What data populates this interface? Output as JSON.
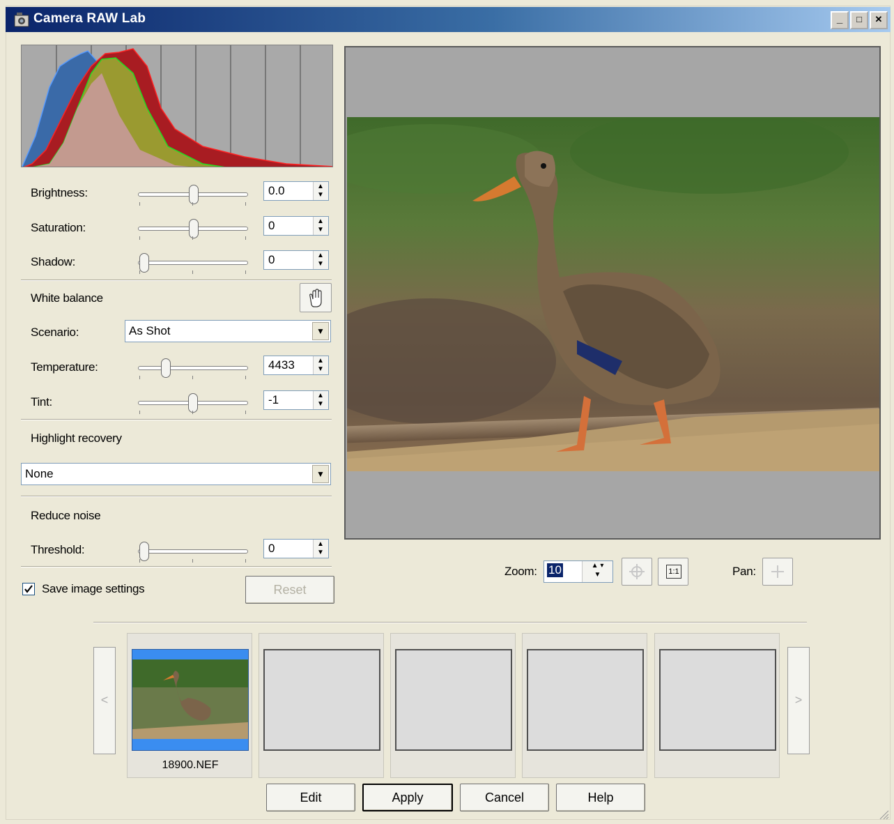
{
  "window": {
    "title": "Camera RAW Lab"
  },
  "titlebar_buttons": {
    "minimize": "_",
    "maximize": "□",
    "close": "✕"
  },
  "adjust": {
    "brightness": {
      "label": "Brightness:",
      "value": "0.0",
      "level": 0.5
    },
    "saturation": {
      "label": "Saturation:",
      "value": "0",
      "level": 0.5
    },
    "shadow": {
      "label": "Shadow:",
      "value": "0",
      "level": 0.0
    }
  },
  "white_balance": {
    "heading": "White balance",
    "scenario_label": "Scenario:",
    "scenario_value": "As Shot",
    "temperature": {
      "label": "Temperature:",
      "value": "4433",
      "level": 0.22
    },
    "tint": {
      "label": "Tint:",
      "value": "-1",
      "level": 0.49
    }
  },
  "highlight": {
    "heading": "Highlight recovery",
    "value": "None"
  },
  "noise": {
    "heading": "Reduce noise",
    "threshold": {
      "label": "Threshold:",
      "value": "0",
      "level": 0.0
    }
  },
  "save_settings": {
    "label": "Save image settings",
    "checked": true
  },
  "reset_label": "Reset",
  "zoom": {
    "label": "Zoom:",
    "value": "10"
  },
  "pan_label": "Pan:",
  "fit_button_label": "1:1",
  "filmstrip": {
    "prev": "<",
    "next": ">",
    "items": [
      {
        "name": "18900.NEF"
      },
      {
        "name": ""
      },
      {
        "name": ""
      },
      {
        "name": ""
      },
      {
        "name": ""
      }
    ]
  },
  "actions": {
    "edit": "Edit",
    "apply": "Apply",
    "cancel": "Cancel",
    "help": "Help"
  },
  "colors": {
    "accent_blue": "#3a8df0",
    "title_start": "#0a246a",
    "hist_red": "#c8102e",
    "hist_green": "#22cc22",
    "hist_blue": "#3366aa"
  }
}
